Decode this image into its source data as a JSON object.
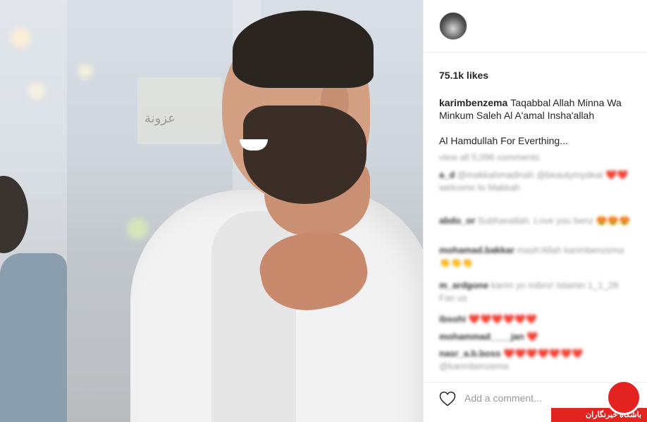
{
  "post": {
    "likes": "75.1k likes",
    "username": "karimbenzema",
    "caption_line1": "Taqabbal Allah Minna Wa Minkum Saleh Al A'amal Insha'allah",
    "caption_line2": "Al Hamdullah For Everthing..."
  },
  "comments_blurred": [
    {
      "text": "view all 5,096 comments"
    },
    {
      "user": "a_d",
      "text": "@makkahmadinah @beautymydeal ❤️❤️ welcome to Makkah"
    },
    {
      "user": "abdo_or",
      "text": "Subhanallah. Love you benz 😍😍😍"
    },
    {
      "user": "mohamad.bakkar",
      "text": "mash'Allah karimbenzema 👏👏👏"
    },
    {
      "user": "m_ardgone",
      "text": "karim yo mibro! Islamin 1_1_28 Fan us"
    },
    {
      "user": "ibsohi",
      "text": "❤️❤️❤️❤️❤️❤️"
    },
    {
      "user": "mohammad____jan",
      "text": "❤️"
    },
    {
      "user": "nasr_a.b.boss",
      "text": "❤️❤️❤️❤️❤️❤️❤️ @karimbenzema"
    }
  ],
  "actions": {
    "add_comment_placeholder": "Add a comment..."
  },
  "watermark": {
    "text": "باشگاه خبرنگاران",
    "color": "#e3231f"
  },
  "photo": {
    "sign_text": "عزونة"
  }
}
